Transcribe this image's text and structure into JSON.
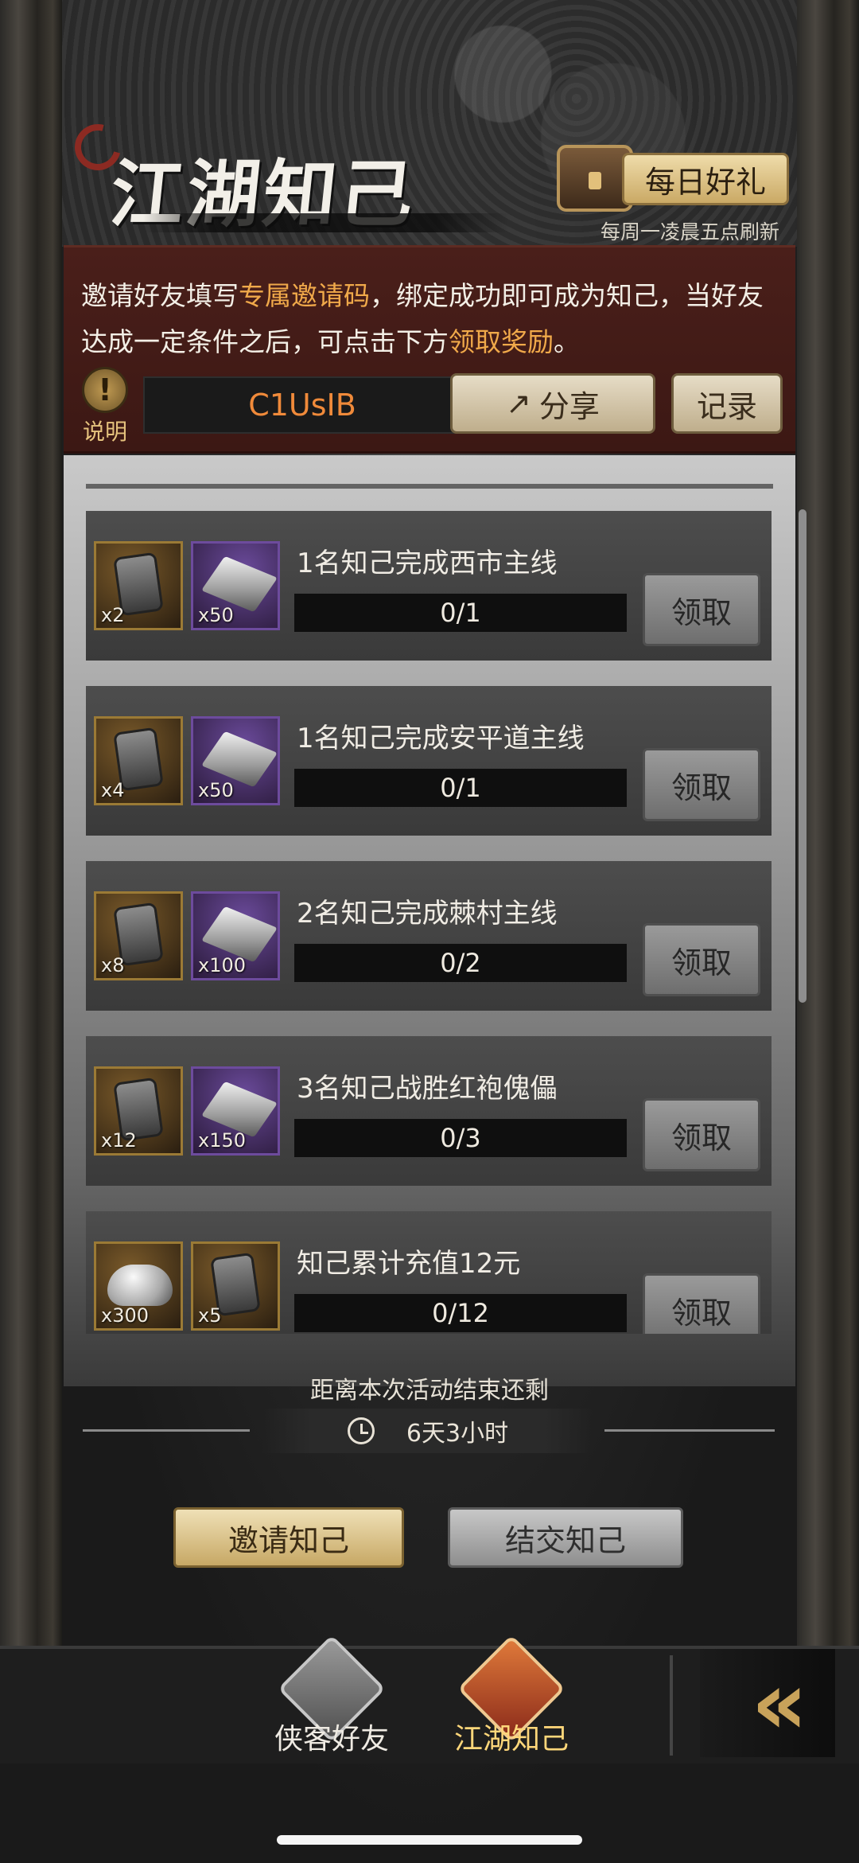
{
  "header": {
    "title": "江湖知己",
    "daily_gift_label": "每日好礼",
    "daily_gift_refresh": "每周一凌晨五点刷新"
  },
  "info": {
    "text_1": "邀请好友填写",
    "text_hl_1": "专属邀请码",
    "text_2": "，绑定成功即可成为知己，当好友达成一定条件之后，可点击下方",
    "text_hl_2": "领取奖励",
    "text_3": "。",
    "help_label": "说明",
    "invite_code": "C1UsIB",
    "share_label": "分享",
    "record_label": "记录",
    "highlight_color": "#f0a94a"
  },
  "tasks": [
    {
      "title": "1名知己完成西市主线",
      "progress": "0/1",
      "claim_label": "领取",
      "rewards": [
        {
          "item": "token-icon",
          "qty": "x2",
          "frame": "gold"
        },
        {
          "item": "silver-bar-icon",
          "qty": "x50",
          "frame": "purple"
        }
      ]
    },
    {
      "title": "1名知己完成安平道主线",
      "progress": "0/1",
      "claim_label": "领取",
      "rewards": [
        {
          "item": "token-icon",
          "qty": "x4",
          "frame": "gold"
        },
        {
          "item": "silver-bar-icon",
          "qty": "x50",
          "frame": "purple"
        }
      ]
    },
    {
      "title": "2名知己完成棘村主线",
      "progress": "0/2",
      "claim_label": "领取",
      "rewards": [
        {
          "item": "token-icon",
          "qty": "x8",
          "frame": "gold"
        },
        {
          "item": "silver-bar-icon",
          "qty": "x100",
          "frame": "purple"
        }
      ]
    },
    {
      "title": "3名知己战胜红袍傀儡",
      "progress": "0/3",
      "claim_label": "领取",
      "rewards": [
        {
          "item": "token-icon",
          "qty": "x12",
          "frame": "gold"
        },
        {
          "item": "silver-bar-icon",
          "qty": "x150",
          "frame": "purple"
        }
      ]
    },
    {
      "title": "知己累计充值12元",
      "progress": "0/12",
      "claim_label": "领取",
      "rewards": [
        {
          "item": "silver-ingot-icon",
          "qty": "x300",
          "frame": "gold"
        },
        {
          "item": "token-icon",
          "qty": "x5",
          "frame": "purple"
        }
      ]
    }
  ],
  "countdown": {
    "label": "距离本次活动结束还剩",
    "value": "6天3小时"
  },
  "actions": {
    "invite_label": "邀请知己",
    "befriend_label": "结交知己"
  },
  "tabs": [
    {
      "label": "侠客好友",
      "icon": "hero-icon",
      "active": false
    },
    {
      "label": "江湖知己",
      "icon": "jianghu-icon",
      "active": true
    }
  ]
}
